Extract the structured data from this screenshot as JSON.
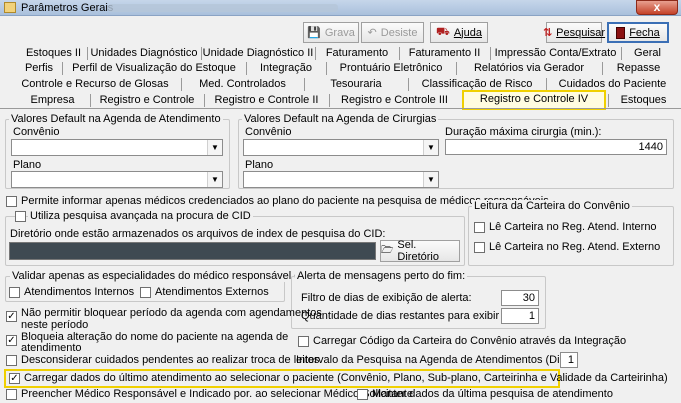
{
  "window": {
    "title": "Parâmetros Gerais",
    "close": "x"
  },
  "toolbar": {
    "grava": "Grava",
    "desiste": "Desiste",
    "ajuda": "Ajuda",
    "pesquisar": "Pesquisar",
    "fecha": "Fecha"
  },
  "tabs": {
    "row1": [
      "Estoques II",
      "Unidades Diagnóstico",
      "Unidade Diagnóstico II",
      "Faturamento",
      "Faturamento II",
      "Impressão Conta/Extrato",
      "Geral"
    ],
    "row2": [
      "Perfis",
      "Perfil de Visualização do Estoque",
      "Integração",
      "Prontuário Eletrônico",
      "Relatórios via Gerador",
      "Repasse"
    ],
    "row3": [
      "Controle e Recurso de Glosas",
      "Med. Controlados",
      "Tesouraria",
      "Classificação de Risco",
      "Cuidados do Paciente"
    ],
    "row4": [
      "Empresa",
      "Registro e Controle",
      "Registro e Controle II",
      "Registro e Controle III",
      "Registro e Controle IV",
      "Estoques"
    ],
    "active": "Registro e Controle IV"
  },
  "atendimento": {
    "title": "Valores Default na Agenda de Atendimento",
    "convenio": "Convênio",
    "plano": "Plano"
  },
  "cirurgias": {
    "title": "Valores Default na Agenda de Cirurgias",
    "convenio": "Convênio",
    "plano": "Plano",
    "duracao_label": "Duração máxima cirurgia (min.):",
    "duracao_value": "1440"
  },
  "checks": {
    "permite_medicos": "Permite informar apenas médicos credenciados ao plano do paciente na pesquisa de médicos responsáveis",
    "pesquisa_cid": "Utiliza pesquisa avançada na procura de CID",
    "diretorio_label": "Diretório onde estão armazenados os arquivos de index de pesquisa do CID:",
    "sel_diretorio": "Sel. Diretório"
  },
  "carteira": {
    "title": "Leitura da Carteira do Convênio",
    "interno": "Lê Carteira no Reg. Atend. Interno",
    "externo": "Lê Carteira no Reg. Atend. Externo"
  },
  "especialidades": {
    "title": "Validar apenas as especialidades do médico responsável em:",
    "internos": "Atendimentos Internos",
    "externos": "Atendimentos Externos"
  },
  "alerta": {
    "title": "Alerta de mensagens perto do fim:",
    "filtro_label": "Filtro de dias de exibição de alerta:",
    "filtro_value": "30",
    "quantidade_label": "Quantidade de dias restantes para exibir alerta:",
    "quantidade_value": "1"
  },
  "bottom": {
    "nao_permitir_1": "Não permitir bloquear período da agenda com agendamentos",
    "nao_permitir_2": "neste período",
    "bloqueia_1": "Bloqueia alteração do nome do paciente na agenda de",
    "bloqueia_2": "atendimento",
    "carregar_codigo": "Carregar Código da Carteira do Convênio através da Integração",
    "desconsiderar": "Desconsiderar cuidados pendentes ao realizar troca de leitos",
    "intervalo_label": "Intervalo da Pesquisa na Agenda de Atendimentos (Dias)",
    "intervalo_value": "1",
    "carregar_dados": "Carregar dados do último atendimento ao selecionar o paciente (Convênio, Plano, Sub-plano, Carteirinha e Validade da Carteirinha)",
    "preencher": "Preencher Médico Responsável e Indicado por. ao selecionar Médico Solicitante",
    "manter": "Manter dados da última pesquisa de atendimento"
  },
  "checked_mark": "✓"
}
